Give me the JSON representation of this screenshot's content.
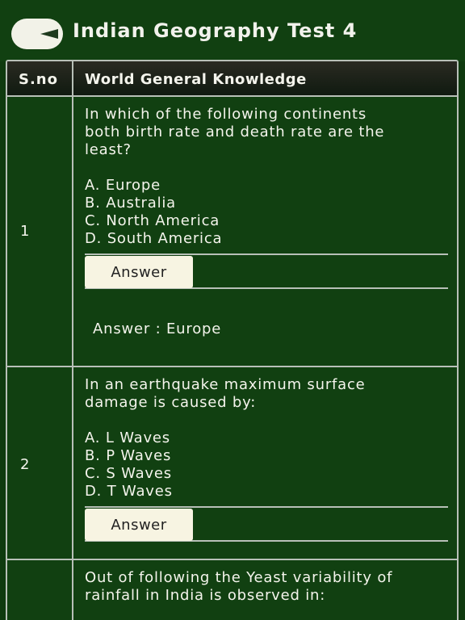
{
  "header": {
    "title": "Indian Geography Test 4",
    "back_icon": "back-arrow-icon"
  },
  "table": {
    "col_sno": "S.no",
    "col_subject": "World General Knowledge"
  },
  "questions": [
    {
      "sno": "1",
      "lines": [
        "In which of the following continents",
        "both birth rate and death rate are the",
        "least?"
      ],
      "options": [
        "A. Europe",
        "B. Australia",
        "C. North America",
        "D. South America"
      ],
      "answer_button": "Answer",
      "answer_text": "Answer : Europe"
    },
    {
      "sno": "2",
      "lines": [
        "In an earthquake maximum surface",
        "damage is caused by:"
      ],
      "options": [
        "A. L Waves",
        "B. P Waves",
        "C. S Waves",
        "D. T Waves"
      ],
      "answer_button": "Answer"
    },
    {
      "lines": [
        "Out of following the Yeast variability of",
        "rainfall in India is observed in:"
      ]
    }
  ]
}
